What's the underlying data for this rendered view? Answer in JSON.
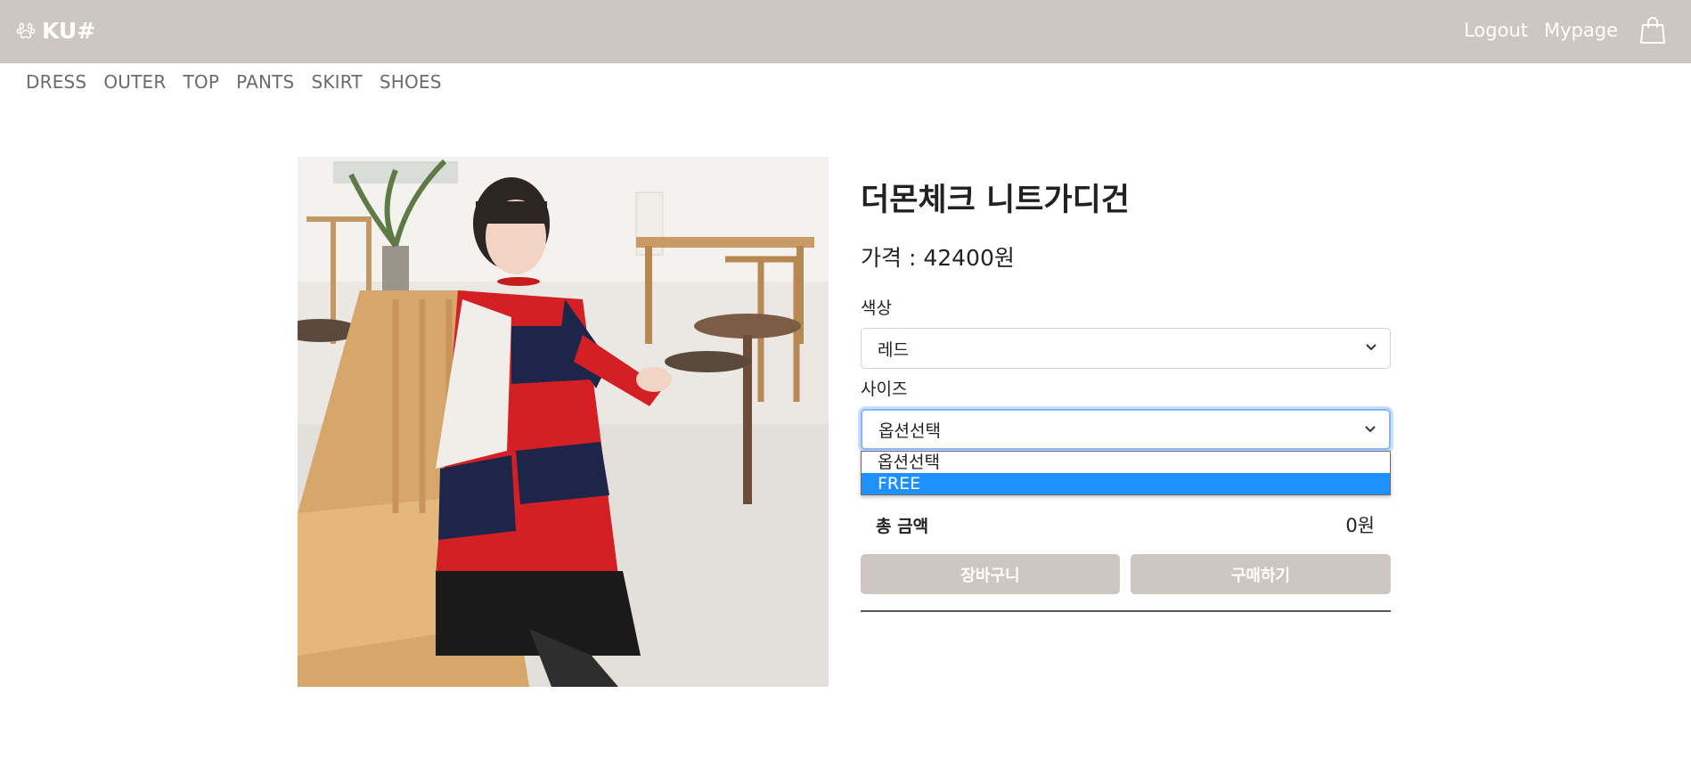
{
  "header": {
    "brand": "KU#",
    "logout": "Logout",
    "mypage": "Mypage",
    "background_color": "#cec6c3"
  },
  "categories": [
    "DRESS",
    "OUTER",
    "TOP",
    "PANTS",
    "SKIRT",
    "SHOES"
  ],
  "product": {
    "name": "더몬체크 니트가디건",
    "price_label": "가격 : ",
    "price_value": "42400원",
    "image": "product-photo"
  },
  "options": {
    "color_label": "색상",
    "color_value": "레드",
    "size_label": "사이즈",
    "size_value": "옵션선택",
    "size_options": [
      "옵션선택",
      "FREE"
    ],
    "highlighted_option": "FREE"
  },
  "summary": {
    "total_label": "총 금액",
    "total_value": "0원"
  },
  "actions": {
    "cart": "장바구니",
    "buy": "구매하기"
  }
}
